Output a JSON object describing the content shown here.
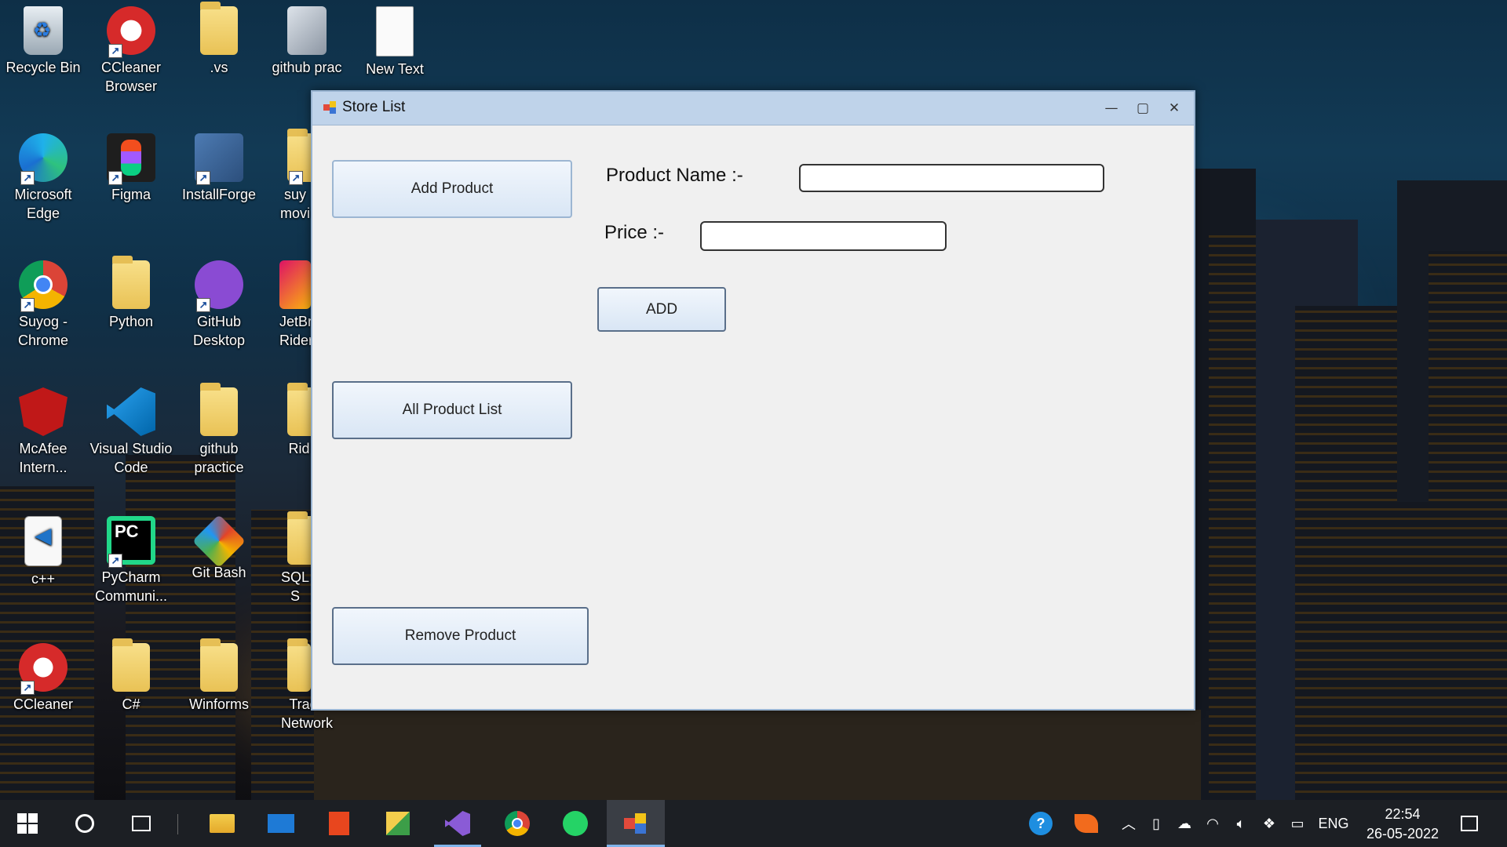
{
  "desktop": {
    "icons": [
      {
        "label": "Recycle Bin"
      },
      {
        "label": "CCleaner Browser"
      },
      {
        "label": ".vs"
      },
      {
        "label": "github prac"
      },
      {
        "label": "New Text"
      },
      {
        "label": "Microsoft Edge"
      },
      {
        "label": "Figma"
      },
      {
        "label": "InstallForge"
      },
      {
        "label": "suy movi"
      },
      {
        "label": "Suyog - Chrome"
      },
      {
        "label": "Python"
      },
      {
        "label": "GitHub Desktop"
      },
      {
        "label": "JetBr Rider"
      },
      {
        "label": "McAfee Intern..."
      },
      {
        "label": "Visual Studio Code"
      },
      {
        "label": "github practice"
      },
      {
        "label": "Rid"
      },
      {
        "label": "c++"
      },
      {
        "label": "PyCharm Communi..."
      },
      {
        "label": "Git Bash"
      },
      {
        "label": "SQL S"
      },
      {
        "label": "CCleaner"
      },
      {
        "label": "C#"
      },
      {
        "label": "Winforms"
      },
      {
        "label": "Tradx Network"
      }
    ]
  },
  "window": {
    "title": "Store List",
    "controls": {
      "minimize": "—",
      "maximize": "▢",
      "close": "✕"
    },
    "buttons": {
      "add_product": "Add Product",
      "all_product_list": "All Product List",
      "remove_product": "Remove Product",
      "add": "ADD"
    },
    "form": {
      "product_name_label": "Product Name :-",
      "product_name_value": "",
      "price_label": "Price :-",
      "price_value": ""
    }
  },
  "taskbar": {
    "apps": [
      "start-icon",
      "search-icon",
      "task-view-icon",
      "file-explorer-icon",
      "mail-icon",
      "office-icon",
      "winforms-app-icon",
      "visual-studio-icon",
      "chrome-icon",
      "whatsapp-icon",
      "store-list-app-icon"
    ],
    "tray": {
      "language": "ENG",
      "time": "22:54",
      "date": "26-05-2022"
    }
  },
  "colors": {
    "titlebar": "#bfd3ea",
    "window_bg": "#f0f0f0",
    "taskbar": "#1c1f24",
    "accent": "#7fb4ea"
  }
}
